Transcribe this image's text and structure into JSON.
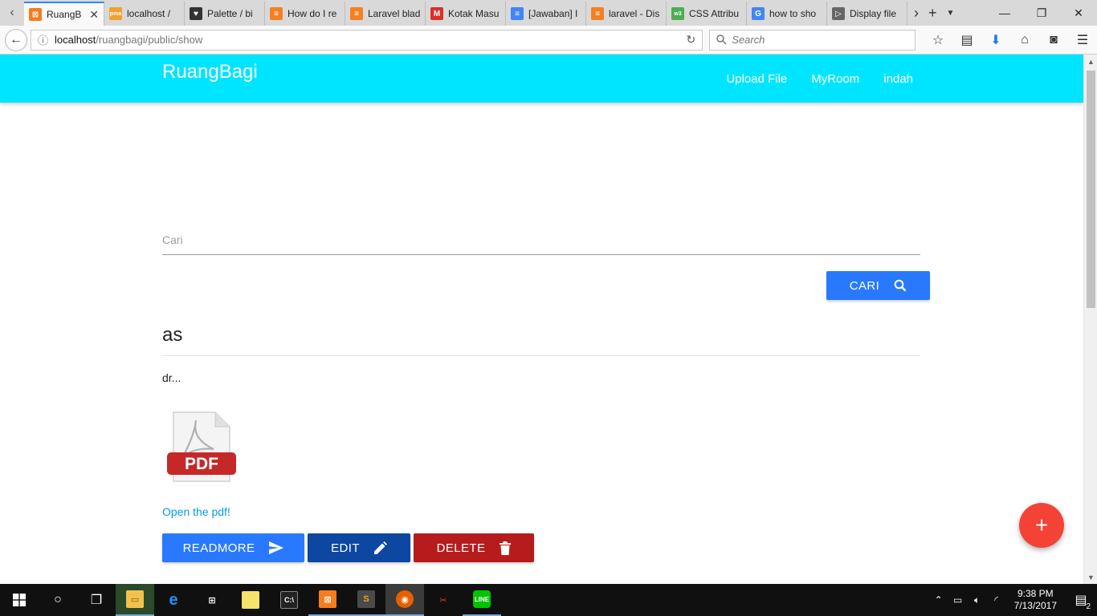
{
  "browser": {
    "tabs": [
      {
        "label": "RuangB",
        "active": true,
        "favicon_color": "#f57c1f",
        "favicon_glyph": "⊠"
      },
      {
        "label": "localhost /",
        "favicon_color": "#f0a030",
        "favicon_glyph": "pma"
      },
      {
        "label": "Palette / bi",
        "favicon_color": "#333333",
        "favicon_glyph": "♥"
      },
      {
        "label": "How do I re",
        "favicon_color": "#f48024",
        "favicon_glyph": "≡"
      },
      {
        "label": "Laravel blad",
        "favicon_color": "#f48024",
        "favicon_glyph": "≡"
      },
      {
        "label": "Kotak Masu",
        "favicon_color": "#d93025",
        "favicon_glyph": "M"
      },
      {
        "label": "[Jawaban] I",
        "favicon_color": "#4285f4",
        "favicon_glyph": "≡"
      },
      {
        "label": "laravel - Dis",
        "favicon_color": "#f48024",
        "favicon_glyph": "≡"
      },
      {
        "label": "CSS Attribu",
        "favicon_color": "#4caf50",
        "favicon_glyph": "w3"
      },
      {
        "label": "how to sho",
        "favicon_color": "#4285f4",
        "favicon_glyph": "G"
      },
      {
        "label": "Display file",
        "favicon_color": "#666666",
        "favicon_glyph": "▷"
      }
    ],
    "url_host": "localhost",
    "url_path": "/ruangbagi/public/show",
    "search_placeholder": "Search"
  },
  "site": {
    "brand": "RuangBagi",
    "header_color": "#00e5ff",
    "nav": [
      {
        "label": "Upload File"
      },
      {
        "label": "MyRoom"
      },
      {
        "label": "indah"
      }
    ]
  },
  "search": {
    "placeholder": "Cari",
    "button_label": "CARI",
    "button_icon": "search-icon"
  },
  "post": {
    "title": "as",
    "excerpt": "dr...",
    "pdf_label": "PDF",
    "link_text": "Open the pdf!",
    "actions": {
      "readmore": "READMORE",
      "edit": "EDIT",
      "delete": "DELETE"
    }
  },
  "fab": {
    "label": "+",
    "color": "#f44336"
  },
  "taskbar": {
    "time": "9:38 PM",
    "date": "7/13/2017",
    "notifications": "2"
  },
  "colors": {
    "primary_button": "#2979ff",
    "edit_button": "#0d47a1",
    "delete_button": "#b71c1c",
    "link": "#039be5"
  }
}
